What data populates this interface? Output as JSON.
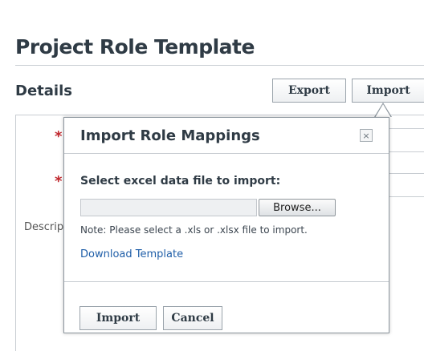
{
  "page": {
    "title": "Project Role Template",
    "section": "Details",
    "export_label": "Export",
    "import_label": "Import",
    "required_marker": "*",
    "desc_label": "Description"
  },
  "dialog": {
    "title": "Import Role Mappings",
    "close_glyph": "×",
    "file_label": "Select excel data file to import:",
    "file_value": "",
    "browse_label": "Browse...",
    "note": "Note: Please select a .xls or .xlsx file to import.",
    "download_link": "Download Template",
    "import_button": "Import",
    "cancel_button": "Cancel"
  }
}
